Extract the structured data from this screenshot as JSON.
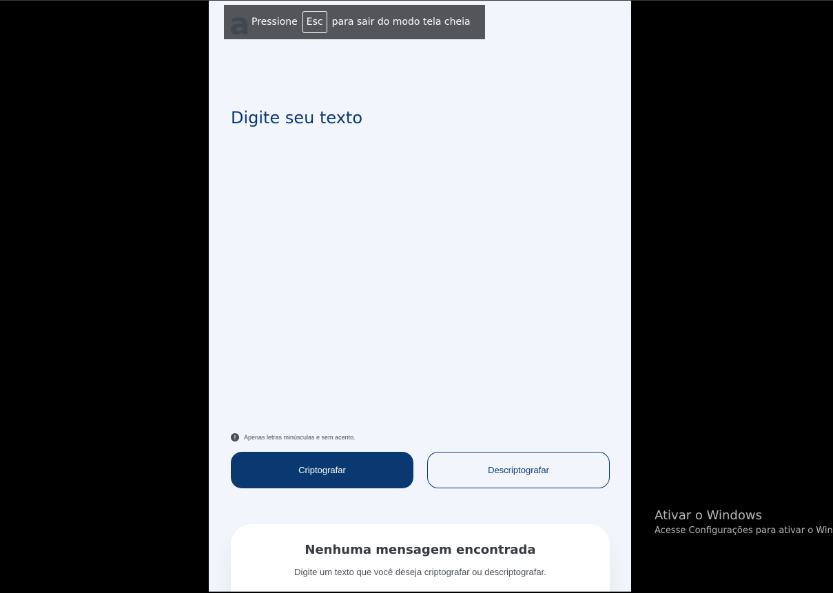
{
  "app": {
    "logo_glyph": "a",
    "input": {
      "value": "",
      "placeholder": "Digite seu texto"
    },
    "hint": {
      "icon": "!",
      "text": "Apenas letras minúsculas e sem acento."
    },
    "buttons": {
      "encrypt": "Criptografar",
      "decrypt": "Descriptografar"
    },
    "result": {
      "title": "Nenhuma mensagem encontrada",
      "text": "Digite um texto que você deseja criptografar ou descriptografar."
    }
  },
  "fullscreen_toast": {
    "before": "Pressione",
    "key": "Esc",
    "after": "para sair do modo tela cheia"
  },
  "windows_watermark": {
    "title": "Ativar o Windows",
    "subtitle": "Acesse Configurações para ativar o Windows."
  },
  "colors": {
    "primary": "#0a3871",
    "page_background": "#f3f5fc",
    "outer_background": "#000000",
    "toast_background": "#46484e"
  }
}
